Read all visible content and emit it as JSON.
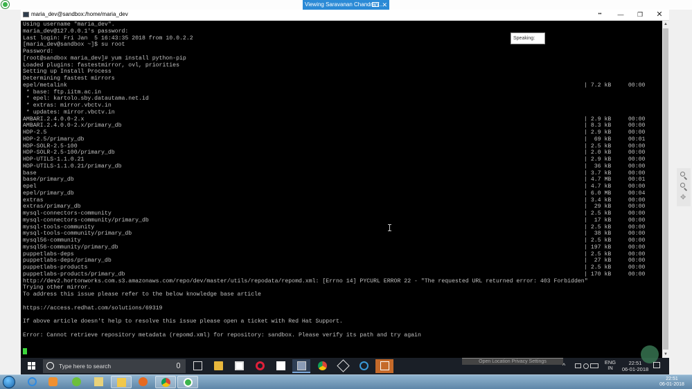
{
  "banner": {
    "label": "Viewing Saravanan Chandran'..."
  },
  "window": {
    "title": "maria_dev@sandbox:/home/maria_dev",
    "minimize_glyph": "—",
    "maximize_glyph": "❐",
    "close_glyph": "✕",
    "dots_glyph": "••"
  },
  "terminal": {
    "lines": [
      "Using username \"maria_dev\".",
      "maria_dev@127.0.0.1's password:",
      "Last login: Fri Jan  5 16:43:35 2018 from 10.0.2.2",
      "[maria_dev@sandbox ~]$ su root",
      "Password:",
      "[root@sandbox maria_dev]# yum install python-pip",
      "Loaded plugins: fastestmirror, ovl, priorities",
      "Setting up Install Process",
      "Determining fastest mirrors",
      "epel/metalink",
      " * base: ftp.iitm.ac.in",
      " * epel: kartolo.sby.datautama.net.id",
      " * extras: mirror.vbctv.in",
      " * updates: mirror.vbctv.in",
      "AMBARI.2.4.0.0-2.x",
      "AMBARI.2.4.0.0-2.x/primary_db",
      "HDP-2.5",
      "HDP-2.5/primary_db",
      "HDP-SOLR-2.5-100",
      "HDP-SOLR-2.5-100/primary_db",
      "HDP-UTILS-1.1.0.21",
      "HDP-UTILS-1.1.0.21/primary_db",
      "base",
      "base/primary_db",
      "epel",
      "epel/primary_db",
      "extras",
      "extras/primary_db",
      "mysql-connectors-community",
      "mysql-connectors-community/primary_db",
      "mysql-tools-community",
      "mysql-tools-community/primary_db",
      "mysql56-community",
      "mysql56-community/primary_db",
      "puppetlabs-deps",
      "puppetlabs-deps/primary_db",
      "puppetlabs-products",
      "puppetlabs-products/primary_db",
      "http://dev2.hortonworks.com.s3.amazonaws.com/repo/dev/master/utils/repodata/repomd.xml: [Errno 14] PYCURL ERROR 22 - \"The requested URL returned error: 403 Forbidden\"",
      "Trying other mirror.",
      "To address this issue please refer to the below knowledge base article",
      "",
      "https://access.redhat.com/solutions/69319",
      "",
      "If above article doesn't help to resolve this issue please open a ticket with Red Hat Support.",
      "",
      "Error: Cannot retrieve repository metadata (repomd.xml) for repository: sandbox. Please verify its path and try again"
    ],
    "right_column": [
      "",
      "",
      "",
      "",
      "",
      "",
      "",
      "",
      "",
      "| 7.2 kB     00:00",
      "",
      "",
      "",
      "",
      "| 2.9 kB     00:00",
      "| 8.3 kB     00:00",
      "| 2.9 kB     00:00",
      "|  69 kB     00:01",
      "| 2.5 kB     00:00",
      "| 2.0 kB     00:00",
      "| 2.9 kB     00:00",
      "|  36 kB     00:00",
      "| 3.7 kB     00:00",
      "| 4.7 MB     00:01",
      "| 4.7 kB     00:00",
      "| 6.0 MB     00:04",
      "| 3.4 kB     00:00",
      "|  29 kB     00:00",
      "| 2.5 kB     00:00",
      "|  17 kB     00:00",
      "| 2.5 kB     00:00",
      "|  38 kB     00:00",
      "| 2.5 kB     00:00",
      "| 197 kB     00:00",
      "| 2.5 kB     00:00",
      "|  27 kB     00:00",
      "| 2.5 kB     00:00",
      "| 170 kB     00:00"
    ]
  },
  "speaking_tooltip": "Speaking:",
  "remote_taskbar": {
    "search_placeholder": "Type here to search",
    "privacy_strip": "Open Location Privacy Settings",
    "language": "ENG",
    "language_sub": "IN",
    "time": "22:51",
    "date": "06-01-2018"
  },
  "local_taskbar": {
    "time": "22:51",
    "date": "06-01-2018"
  }
}
